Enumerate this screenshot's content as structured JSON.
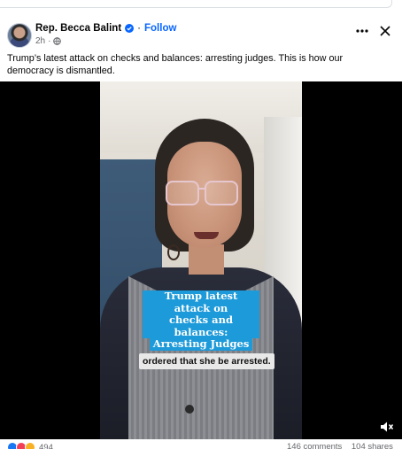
{
  "post": {
    "author": "Rep. Becca Balint",
    "follow_label": "Follow",
    "time": "2h",
    "dot": "·",
    "text": "Trump’s latest attack on checks and balances: arresting judges. This is how our democracy is dismantled."
  },
  "video": {
    "caption_lines": [
      "Trump latest attack on",
      "checks and balances:",
      "Arresting Judges"
    ],
    "subtitle": "ordered that she be arrested."
  },
  "footer": {
    "reaction_count": "494",
    "comments": "146 comments",
    "shares": "104 shares"
  },
  "icons": {
    "verified": "verified-badge-icon",
    "globe": "globe-icon",
    "more": "more-options-icon",
    "close": "close-icon",
    "volume": "volume-icon"
  },
  "colors": {
    "accent": "#0866ff",
    "caption_bg": "#1d9ad9"
  }
}
